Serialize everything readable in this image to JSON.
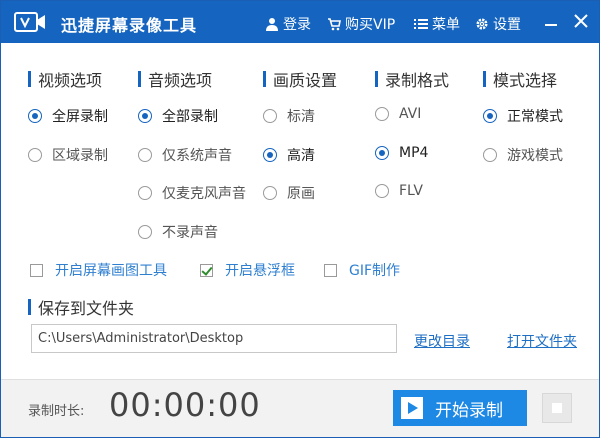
{
  "titlebar": {
    "title": "迅捷屏幕录像工具",
    "login": "登录",
    "buy_vip": "购买VIP",
    "menu": "菜单",
    "settings": "设置",
    "icons": [
      "user-icon",
      "cart-icon",
      "menu-icon",
      "gear-icon",
      "minimize-icon",
      "close-icon"
    ]
  },
  "sections": {
    "video": {
      "label": "视频选项",
      "options": [
        {
          "label": "全屏录制",
          "selected": true
        },
        {
          "label": "区域录制",
          "selected": false
        }
      ]
    },
    "audio": {
      "label": "音频选项",
      "options": [
        {
          "label": "全部录制",
          "selected": true
        },
        {
          "label": "仅系统声音",
          "selected": false
        },
        {
          "label": "仅麦克风声音",
          "selected": false
        },
        {
          "label": "不录声音",
          "selected": false
        }
      ]
    },
    "quality": {
      "label": "画质设置",
      "options": [
        {
          "label": "标清",
          "selected": false
        },
        {
          "label": "高清",
          "selected": true
        },
        {
          "label": "原画",
          "selected": false
        }
      ]
    },
    "format": {
      "label": "录制格式",
      "options": [
        {
          "label": "AVI",
          "selected": false
        },
        {
          "label": "MP4",
          "selected": true
        },
        {
          "label": "FLV",
          "selected": false
        }
      ]
    },
    "mode": {
      "label": "模式选择",
      "options": [
        {
          "label": "正常模式",
          "selected": true
        },
        {
          "label": "游戏模式",
          "selected": false
        }
      ]
    }
  },
  "checkboxes": [
    {
      "label": "开启屏幕画图工具",
      "checked": false
    },
    {
      "label": "开启悬浮框",
      "checked": true
    },
    {
      "label": "GIF制作",
      "checked": false
    }
  ],
  "save": {
    "label": "保存到文件夹",
    "path": "C:\\Users\\Administrator\\Desktop",
    "change_dir": "更改目录",
    "open_folder": "打开文件夹"
  },
  "footer": {
    "duration_label": "录制时长:",
    "duration_value": "00:00:00",
    "start_label": "开始录制"
  },
  "colors": {
    "titlebar": "#1565c0",
    "accent": "#1e88e5",
    "link": "#1f6fc5"
  }
}
